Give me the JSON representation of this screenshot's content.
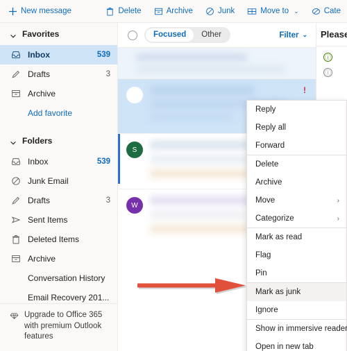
{
  "toolbar": {
    "new_message": "New message",
    "items": [
      {
        "label": "Delete",
        "icon": "trash-icon"
      },
      {
        "label": "Archive",
        "icon": "archive-box-icon"
      },
      {
        "label": "Junk",
        "icon": "block-circle-icon"
      },
      {
        "label": "Move to",
        "icon": "move-to-icon",
        "caret": "⌄"
      },
      {
        "label": "Cate",
        "icon": "categorize-icon"
      }
    ]
  },
  "sidebar": {
    "favorites": {
      "title": "Favorites",
      "items": [
        {
          "label": "Inbox",
          "count": "539",
          "icon": "inbox-icon",
          "selected": true
        },
        {
          "label": "Drafts",
          "count": "3",
          "icon": "pencil-icon",
          "selected": false
        },
        {
          "label": "Archive",
          "count": "",
          "icon": "archive-box-icon",
          "selected": false
        }
      ],
      "add_favorite": "Add favorite"
    },
    "folders": {
      "title": "Folders",
      "items": [
        {
          "label": "Inbox",
          "count": "539",
          "icon": "inbox-icon",
          "highlight_count": true
        },
        {
          "label": "Junk Email",
          "count": "",
          "icon": "block-circle-icon"
        },
        {
          "label": "Drafts",
          "count": "3",
          "icon": "pencil-icon"
        },
        {
          "label": "Sent Items",
          "count": "",
          "icon": "send-icon"
        },
        {
          "label": "Deleted Items",
          "count": "",
          "icon": "trash-icon"
        },
        {
          "label": "Archive",
          "count": "",
          "icon": "archive-box-icon"
        },
        {
          "label": "Conversation History",
          "count": "",
          "icon": "none"
        },
        {
          "label": "Email Recovery 201...",
          "count": "",
          "icon": "none"
        }
      ]
    },
    "upgrade": {
      "text": "Upgrade to Office 365 with premium Outlook features",
      "icon": "diamond-icon"
    }
  },
  "message_list": {
    "select_all_icon": "select-all-circle-icon",
    "pivots": [
      {
        "label": "Focused",
        "active": true
      },
      {
        "label": "Other",
        "active": false
      }
    ],
    "filter_label": "Filter",
    "filter_caret": "⌄",
    "rows": [
      {
        "avatar_initial": "",
        "avatar_color": "#ffffff",
        "selected": false,
        "importance": "",
        "redacted": true
      },
      {
        "avatar_initial": "",
        "avatar_color": "#ffffff",
        "selected": true,
        "importance": "!",
        "redacted": true
      },
      {
        "avatar_initial": "S",
        "avatar_color": "#1e6c41",
        "selected": false,
        "importance": "",
        "redacted": true
      },
      {
        "avatar_initial": "W",
        "avatar_color": "#7630ab",
        "selected": false,
        "importance": "",
        "redacted": true
      }
    ]
  },
  "reading_pane": {
    "subject": "Please",
    "icons": [
      {
        "glyph": "ⓘ",
        "color": "#498205",
        "name": "info-icon-green"
      },
      {
        "glyph": "ⓘ",
        "color": "#8a8886",
        "name": "info-icon-gray"
      }
    ],
    "avatar_color": "#498205"
  },
  "context_menu": {
    "items": [
      {
        "label": "Reply",
        "submenu": false,
        "highlight": false,
        "divider_after": false
      },
      {
        "label": "Reply all",
        "submenu": false,
        "highlight": false,
        "divider_after": false
      },
      {
        "label": "Forward",
        "submenu": false,
        "highlight": false,
        "divider_after": true
      },
      {
        "label": "Delete",
        "submenu": false,
        "highlight": false,
        "divider_after": false
      },
      {
        "label": "Archive",
        "submenu": false,
        "highlight": false,
        "divider_after": false
      },
      {
        "label": "Move",
        "submenu": true,
        "highlight": false,
        "divider_after": false
      },
      {
        "label": "Categorize",
        "submenu": true,
        "highlight": false,
        "divider_after": true
      },
      {
        "label": "Mark as read",
        "submenu": false,
        "highlight": false,
        "divider_after": false
      },
      {
        "label": "Flag",
        "submenu": false,
        "highlight": false,
        "divider_after": false
      },
      {
        "label": "Pin",
        "submenu": false,
        "highlight": false,
        "divider_after": true
      },
      {
        "label": "Mark as junk",
        "submenu": false,
        "highlight": true,
        "divider_after": false
      },
      {
        "label": "Ignore",
        "submenu": false,
        "highlight": false,
        "divider_after": true
      },
      {
        "label": "Show in immersive reader",
        "submenu": false,
        "highlight": false,
        "divider_after": false
      },
      {
        "label": "Open in new tab",
        "submenu": false,
        "highlight": false,
        "divider_after": false
      }
    ],
    "submenu_marker": "›"
  },
  "annotation": {
    "arrow_color": "#e0503a",
    "points_to": "Mark as junk"
  },
  "colors": {
    "accent": "#0f6cbd",
    "selection_blue": "#cfe4f7",
    "rail_blue": "#2b6fd4",
    "importance_red": "#c4314b",
    "chrome_gray": "#faf9f8"
  }
}
